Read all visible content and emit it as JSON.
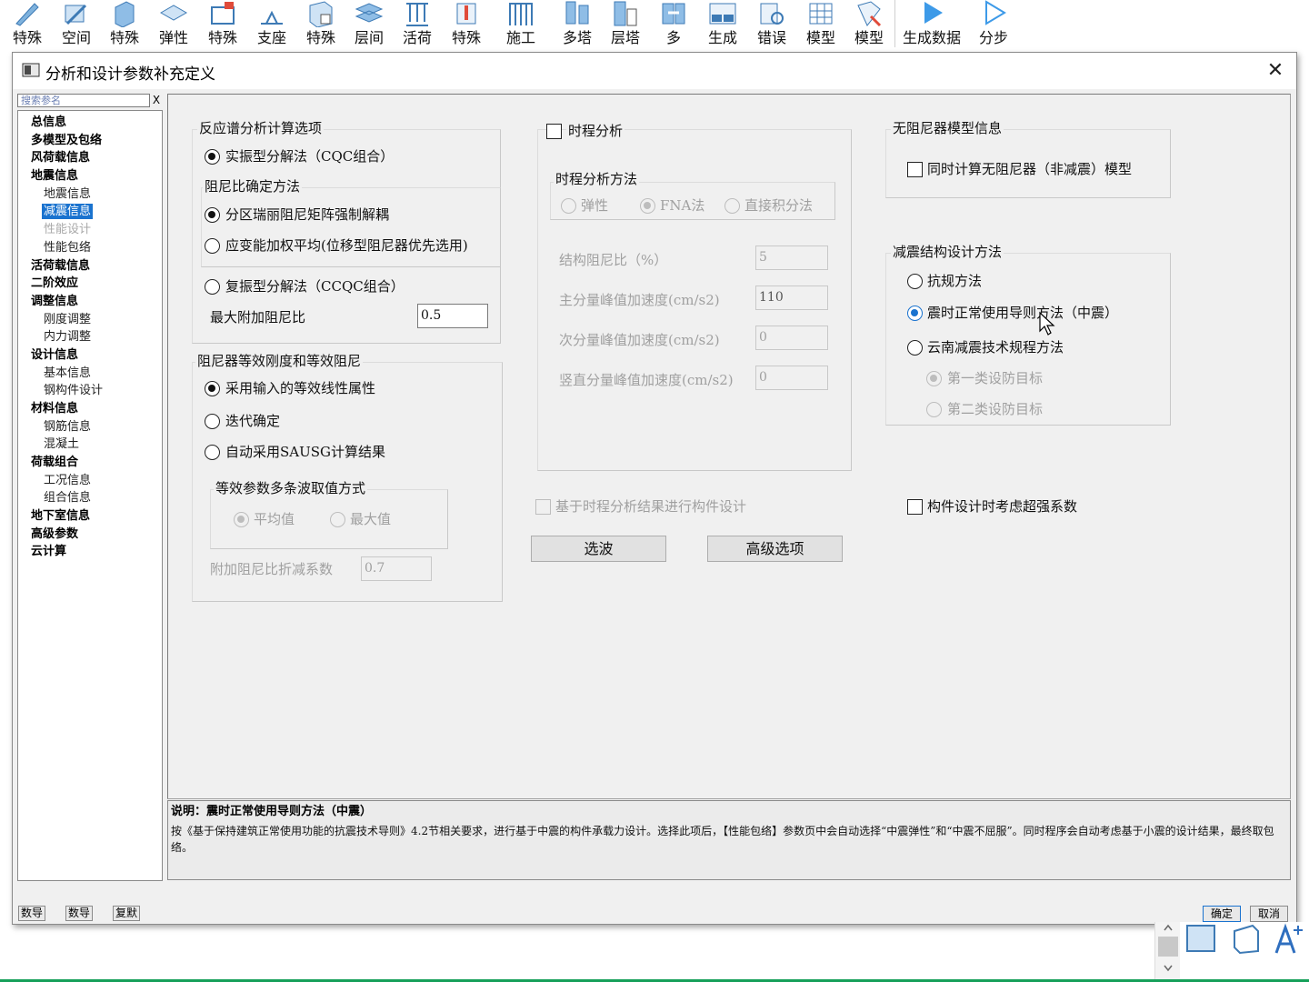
{
  "ribbon": {
    "buttons": [
      {
        "label": "特殊",
        "icon": "pen-icon"
      },
      {
        "label": "空间",
        "icon": "space-member-icon"
      },
      {
        "label": "特殊",
        "icon": "beam-icon"
      },
      {
        "label": "弹性",
        "icon": "elastic-slab-icon"
      },
      {
        "label": "特殊",
        "icon": "special-frame-icon"
      },
      {
        "label": "支座",
        "icon": "support-icon"
      },
      {
        "label": "特殊",
        "icon": "special-floor-icon"
      },
      {
        "label": "层间",
        "icon": "interlayer-icon"
      },
      {
        "label": "活荷",
        "icon": "live-load-icon"
      },
      {
        "label": "特殊",
        "icon": "temperature-icon"
      },
      {
        "label": "施工",
        "icon": "construction-icon"
      },
      {
        "label": "多塔",
        "icon": "multi-tower-icon"
      },
      {
        "label": "层塔",
        "icon": "floor-tower-icon"
      },
      {
        "label": "多",
        "icon": "multi-model-icon"
      },
      {
        "label": "生成",
        "icon": "generate-dm-am-icon"
      },
      {
        "label": "错误",
        "icon": "error-check-icon"
      },
      {
        "label": "模型",
        "icon": "model-grid-icon"
      },
      {
        "label": "模型",
        "icon": "model-edit-icon"
      },
      {
        "label": "生成数据",
        "icon": "play-icon"
      },
      {
        "label": "分步",
        "icon": "play-outline-icon"
      }
    ]
  },
  "dialog": {
    "title": "分析和设计参数补充定义",
    "close": "✕"
  },
  "nav": {
    "search_placeholder": "搜索参名",
    "search_clear": "X",
    "items": [
      {
        "label": "总信息"
      },
      {
        "label": "多模型及包络"
      },
      {
        "label": "风荷载信息"
      },
      {
        "label": "地震信息"
      },
      {
        "label": "地震信息"
      },
      {
        "label": "减震信息"
      },
      {
        "label": "性能设计"
      },
      {
        "label": "性能包络"
      },
      {
        "label": "活荷载信息"
      },
      {
        "label": "二阶效应"
      },
      {
        "label": "调整信息"
      },
      {
        "label": "刚度调整"
      },
      {
        "label": "内力调整"
      },
      {
        "label": "设计信息"
      },
      {
        "label": "基本信息"
      },
      {
        "label": "钢构件设计"
      },
      {
        "label": "材料信息"
      },
      {
        "label": "钢筋信息"
      },
      {
        "label": "混凝土"
      },
      {
        "label": "荷载组合"
      },
      {
        "label": "工况信息"
      },
      {
        "label": "组合信息"
      },
      {
        "label": "地下室信息"
      },
      {
        "label": "高级参数"
      },
      {
        "label": "云计算"
      }
    ],
    "bottom_buttons": [
      "数导",
      "数导",
      "复默"
    ]
  },
  "response": {
    "title": "反应谱分析计算选项",
    "opt_cqc": "实振型分解法（CQC组合）",
    "damping_group": "阻尼比确定方法",
    "opt_rayleigh": "分区瑞丽阻尼矩阵强制解耦",
    "opt_strain": "应变能加权平均(位移型阻尼器优先选用)",
    "opt_ccqc": "复振型分解法（CCQC组合）",
    "max_damping_label": "最大附加阻尼比",
    "max_damping_value": "0.5"
  },
  "equiv": {
    "title": "阻尼器等效刚度和等效阻尼",
    "opt_input": "采用输入的等效线性属性",
    "opt_iter": "迭代确定",
    "opt_sausg": "自动采用SAUSG计算结果",
    "multi_wave_group": "等效参数多条波取值方式",
    "opt_avg": "平均值",
    "opt_max": "最大值",
    "reduction_label": "附加阻尼比折减系数",
    "reduction_value": "0.7"
  },
  "timehistory": {
    "enable_label": "时程分析",
    "method_group": "时程分析方法",
    "opt_elastic": "弹性",
    "opt_fna": "FNA法",
    "opt_direct": "直接积分法",
    "struct_damping_label": "结构阻尼比（%）",
    "struct_damping_value": "5",
    "main_accel_label": "主分量峰值加速度(cm/s2)",
    "main_accel_value": "110",
    "sec_accel_label": "次分量峰值加速度(cm/s2)",
    "sec_accel_value": "0",
    "vert_accel_label": "竖直分量峰值加速度(cm/s2)",
    "vert_accel_value": "0",
    "design_label": "基于时程分析结果进行构件设计",
    "select_wave_btn": "选波",
    "advanced_btn": "高级选项"
  },
  "nodamper": {
    "title": "无阻尼器模型信息",
    "check_label": "同时计算无阻尼器（非减震）模型"
  },
  "design_method": {
    "title": "减震结构设计方法",
    "opt_code": "抗规方法",
    "opt_guide": "震时正常使用导则方法（中震）",
    "opt_yunnan": "云南减震技术规程方法",
    "opt_class1": "第一类设防目标",
    "opt_class2": "第二类设防目标"
  },
  "overstrength_label": "构件设计时考虑超强系数",
  "description": {
    "title": "说明：震时正常使用导则方法（中震）",
    "body": "按《基于保持建筑正常使用功能的抗震技术导则》4.2节相关要求，进行基于中震的构件承载力设计。选择此项后，【性能包络】参数页中会自动选择“中震弹性”和“中震不屈服”。同时程序会自动考虑基于小震的设计结果，最终取包络。"
  },
  "buttons": {
    "ok": "确定",
    "cancel": "取消"
  },
  "colors": {
    "accent": "#1a73cf",
    "dialog_bg": "#f0f0f0",
    "status_bar": "#16a05a"
  }
}
